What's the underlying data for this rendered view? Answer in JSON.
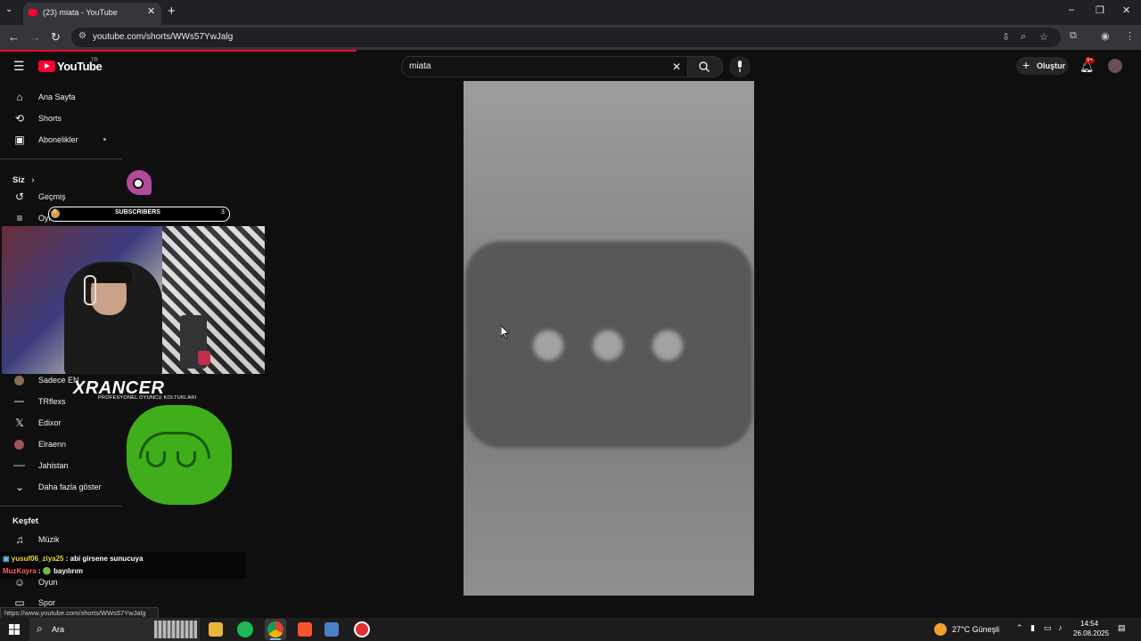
{
  "browser": {
    "tab_title": "(23) miata - YouTube",
    "tab_close": "✕",
    "new_tab": "+",
    "tab_list": "⌄",
    "url": "youtube.com/shorts/WWs57YwJalg",
    "window_controls": {
      "minimize": "–",
      "maximize": "❐",
      "close": "✕"
    },
    "nav": {
      "back": "←",
      "forward": "→",
      "reload": "↻"
    }
  },
  "youtube": {
    "logo_text": "YouTube",
    "region": "TR",
    "search": {
      "value": "miata",
      "clear": "✕"
    },
    "create_label": "Oluştur",
    "notification_count": "9+"
  },
  "sidebar": {
    "main": [
      {
        "label": "Ana Sayfa",
        "icon": "home-icon"
      },
      {
        "label": "Shorts",
        "icon": "shorts-icon"
      },
      {
        "label": "Abonelikler",
        "icon": "subscriptions-icon"
      }
    ],
    "you_header": "Siz",
    "you_chevron": "›",
    "you": [
      {
        "label": "Geçmiş",
        "icon": "history-icon"
      },
      {
        "label": "Oynatma listeleri",
        "icon": "playlist-icon"
      }
    ],
    "subscriptions": [
      {
        "label": "Sadece EN",
        "icon": "channel-avatar"
      },
      {
        "label": "TRflexs",
        "icon": "channel-avatar"
      },
      {
        "label": "Edixor",
        "icon": "x-icon"
      },
      {
        "label": "Elraenn",
        "icon": "channel-avatar"
      },
      {
        "label": "Jahistan",
        "icon": "channel-avatar"
      }
    ],
    "show_more": "Daha fazla göster",
    "explore_header": "Keşfet",
    "explore": [
      {
        "label": "Müzik",
        "icon": "music-icon"
      },
      {
        "label": "Oyun",
        "icon": "gaming-icon"
      },
      {
        "label": "Spor",
        "icon": "sports-icon"
      }
    ]
  },
  "overlay": {
    "subscribers_label": "SUBSCRIBERS",
    "subscribers_left": "0",
    "subscribers_right": "3",
    "sponsor_brand": "XRANCER",
    "sponsor_tagline": "PROFESYONEL OYUNCU KOLTUKLARI",
    "chat": [
      {
        "user": "yusuf06_ziya25",
        "message": ": abi girsene sunucuya",
        "color": "#e8d83a"
      },
      {
        "user": "MuzKayra",
        "message": ": 🟢 bayılırım",
        "color": "#ff5e5e"
      }
    ]
  },
  "status_url": "https://www.youtube.com/shorts/WWs57YwJalg",
  "taskbar": {
    "search_placeholder": "Ara",
    "weather": "27°C  Güneşli",
    "time": "14:54",
    "date": "26.08.2025"
  }
}
